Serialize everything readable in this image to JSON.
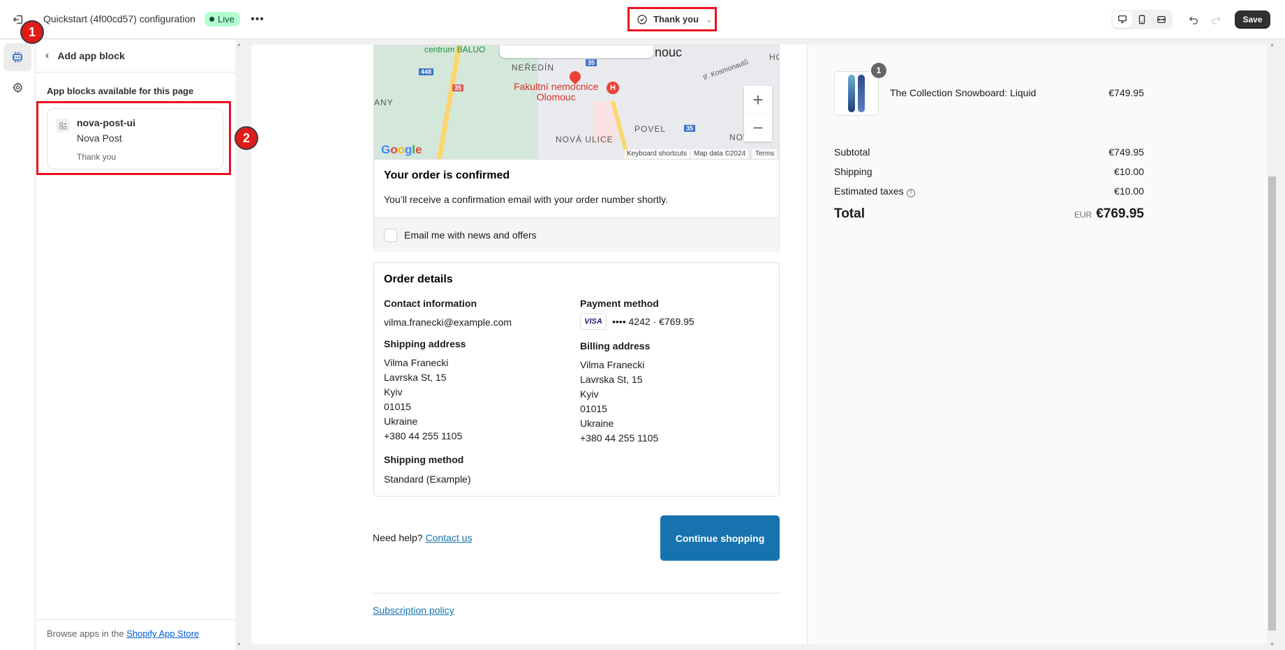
{
  "topbar": {
    "exit_icon": "exit-icon",
    "app_title": "Quickstart (4f00cd57) configuration",
    "status_badge": "Live",
    "more_icon": "•••",
    "page_selector": {
      "label": "Thank you",
      "icon": "check-circle-icon"
    },
    "device_buttons": [
      "desktop",
      "mobile",
      "fullscreen"
    ],
    "undo_icon": "undo-icon",
    "redo_icon": "redo-icon",
    "save_label": "Save"
  },
  "annotations": [
    "1",
    "2"
  ],
  "sidebar": {
    "rail_items": [
      {
        "icon": "sections-icon",
        "active": true
      },
      {
        "icon": "gear-icon",
        "active": false
      }
    ],
    "header_title": "Add app block",
    "section_title": "App blocks available for this page",
    "blocks": [
      {
        "name": "nova-post-ui",
        "app": "Nova Post",
        "page": "Thank you"
      }
    ],
    "footer_text": "Browse apps in the ",
    "footer_link": "Shopify App Store"
  },
  "map": {
    "labels": [
      "centrum BALUO",
      "NEŘEDÍN",
      "ANY",
      "Fakultní nemocnice",
      "Olomouc",
      "POVEL",
      "NOVÁ ULICE",
      "nouc",
      "HO",
      "tř. Kosmonautů",
      "NOV"
    ],
    "road_shields": [
      "448",
      "35",
      "35",
      "35"
    ],
    "google_logo": "Google",
    "attribution": [
      "Keyboard shortcuts",
      "Map data ©2024",
      "Terms"
    ],
    "zoom_in": "+",
    "zoom_out": "−"
  },
  "confirmation": {
    "title": "Your order is confirmed",
    "message": "You’ll receive a confirmation email with your order number shortly.",
    "newsletter_label": "Email me with news and offers",
    "newsletter_checked": false
  },
  "order_details": {
    "title": "Order details",
    "contact_title": "Contact information",
    "contact_email": "vilma.franecki@example.com",
    "payment_title": "Payment method",
    "payment_brand": "VISA",
    "payment_text": "•••• 4242 · €769.95",
    "shipping_address_title": "Shipping address",
    "shipping_address": [
      "Vilma Franecki",
      "Lavrska St, 15",
      "Kyiv",
      "01015",
      "Ukraine",
      "+380 44 255 1105"
    ],
    "billing_address_title": "Billing address",
    "billing_address": [
      "Vilma Franecki",
      "Lavrska St, 15",
      "Kyiv",
      "01015",
      "Ukraine",
      "+380 44 255 1105"
    ],
    "shipping_method_title": "Shipping method",
    "shipping_method": "Standard (Example)"
  },
  "footer": {
    "help_text": "Need help?",
    "contact_link": "Contact us",
    "continue_button": "Continue shopping",
    "subscription_link": "Subscription policy"
  },
  "summary": {
    "item": {
      "name": "The Collection Snowboard: Liquid",
      "price": "€749.95",
      "quantity": "1"
    },
    "subtotal_label": "Subtotal",
    "subtotal": "€749.95",
    "shipping_label": "Shipping",
    "shipping": "€10.00",
    "taxes_label": "Estimated taxes",
    "taxes": "€10.00",
    "total_label": "Total",
    "currency": "EUR",
    "total": "€769.95"
  },
  "colors": {
    "accent": "#1773b0",
    "annotation": "#e8101f",
    "live_badge": "#b4fed2"
  }
}
